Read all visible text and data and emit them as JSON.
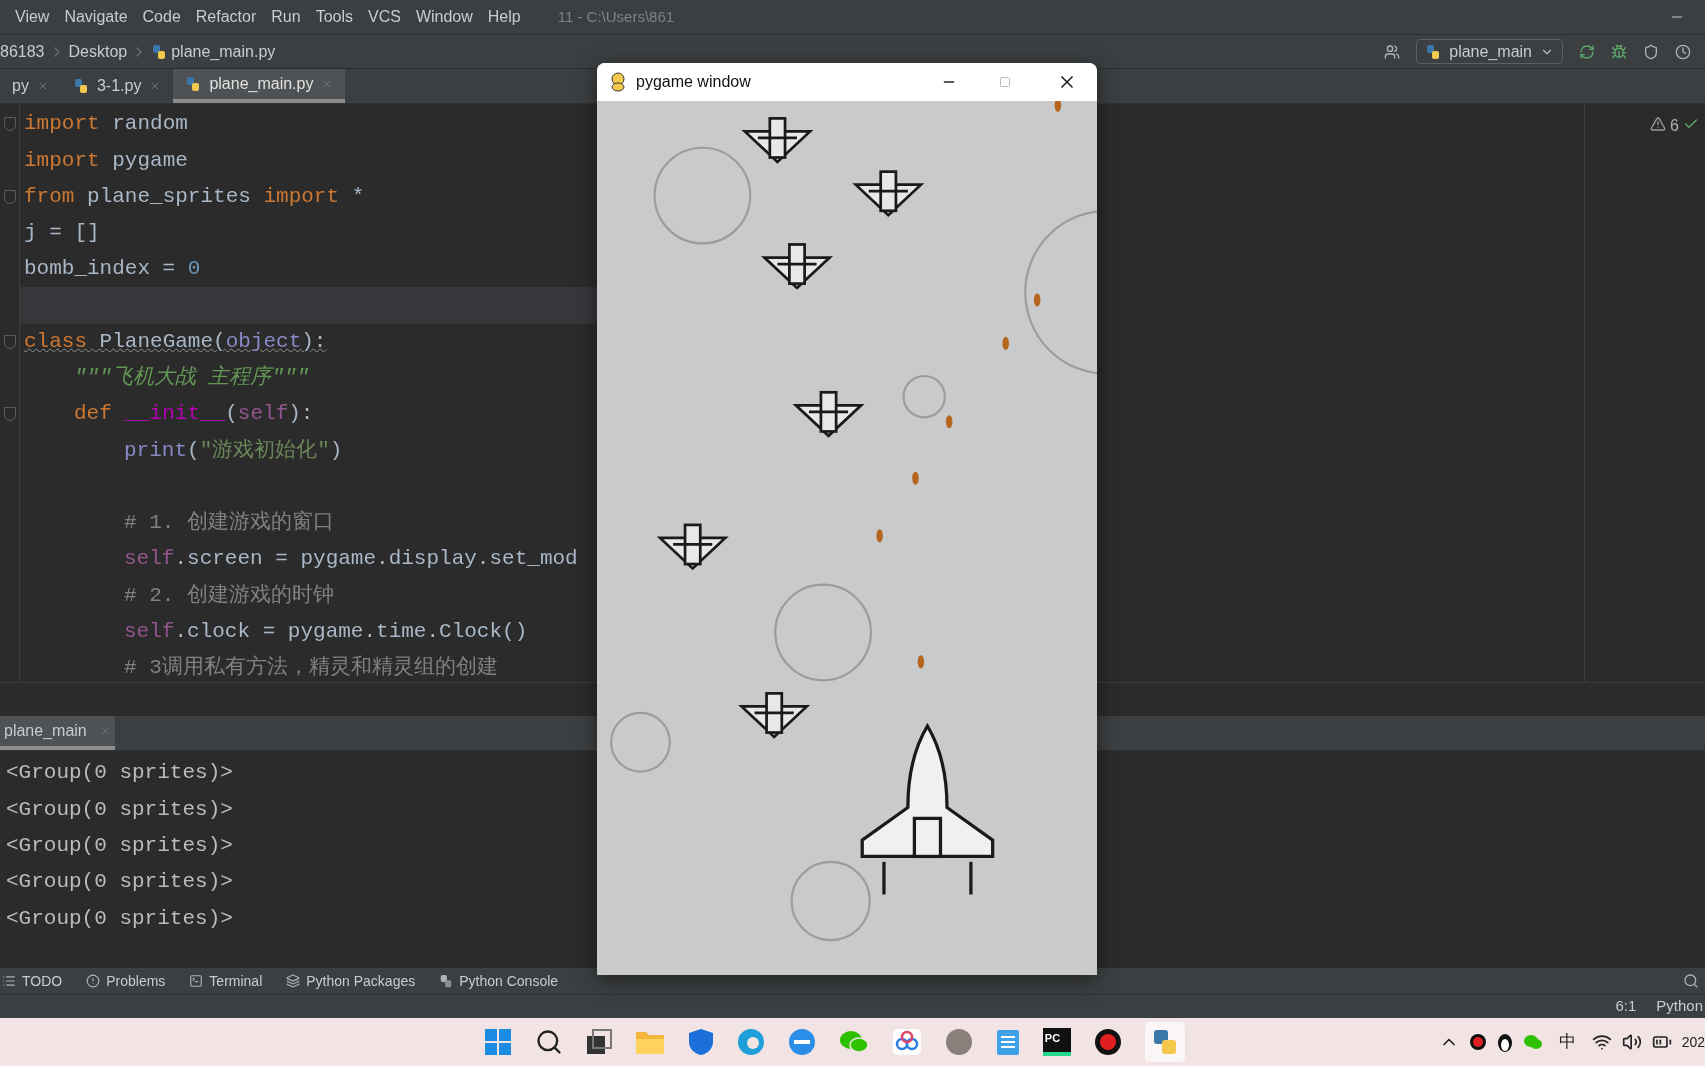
{
  "menu_bar": {
    "items": [
      "View",
      "Navigate",
      "Code",
      "Refactor",
      "Run",
      "Tools",
      "VCS",
      "Window",
      "Help"
    ],
    "title": "11 - C:\\Users\\861"
  },
  "breadcrumbs": [
    "86183",
    "Desktop",
    "plane_main.py"
  ],
  "toolbar": {
    "run_config": "plane_main"
  },
  "editor_tabs": [
    {
      "label": "py",
      "selected": false
    },
    {
      "label": "3-1.py",
      "selected": false
    },
    {
      "label": "plane_main.py",
      "selected": true
    }
  ],
  "editor": {
    "warning_count": "6",
    "lines": [
      {
        "kind": "code",
        "fold": true,
        "underlined": false,
        "tokens": [
          {
            "text": "import",
            "kind": "keyword"
          },
          {
            "text": " random",
            "kind": "plain"
          }
        ]
      },
      {
        "kind": "code",
        "fold": false,
        "underlined": false,
        "tokens": [
          {
            "text": "import",
            "kind": "keyword"
          },
          {
            "text": " pygame",
            "kind": "plain"
          }
        ]
      },
      {
        "kind": "code",
        "fold": true,
        "underlined": false,
        "tokens": [
          {
            "text": "from",
            "kind": "keyword"
          },
          {
            "text": " plane_sprites ",
            "kind": "plain"
          },
          {
            "text": "import",
            "kind": "keyword"
          },
          {
            "text": " *",
            "kind": "plain"
          }
        ]
      },
      {
        "kind": "code",
        "fold": false,
        "underlined": false,
        "tokens": [
          {
            "text": "j = []",
            "kind": "plain"
          }
        ]
      },
      {
        "kind": "code",
        "fold": false,
        "underlined": false,
        "tokens": [
          {
            "text": "bomb_index = ",
            "kind": "plain"
          },
          {
            "text": "0",
            "kind": "number"
          }
        ]
      },
      {
        "kind": "caret_line"
      },
      {
        "kind": "code",
        "fold": true,
        "underlined": true,
        "tokens": [
          {
            "text": "class",
            "kind": "keyword"
          },
          {
            "text": " PlaneGame(",
            "kind": "plain"
          },
          {
            "text": "object",
            "kind": "builtin"
          },
          {
            "text": "):",
            "kind": "plain"
          }
        ],
        "children": [
          {
            "kind": "code",
            "fold": false,
            "underlined": false,
            "tokens": [
              {
                "text": "\"\"\"飞机大战 主程序\"\"\"",
                "kind": "docstring"
              }
            ]
          },
          {
            "kind": "code",
            "fold": true,
            "underlined": false,
            "tokens": [
              {
                "text": "def",
                "kind": "keyword"
              },
              {
                "text": " __init__",
                "kind": "magic"
              },
              {
                "text": "(",
                "kind": "plain"
              },
              {
                "text": "self",
                "kind": "self"
              },
              {
                "text": "):",
                "kind": "plain"
              }
            ],
            "children": [
              {
                "kind": "code",
                "fold": false,
                "underlined": false,
                "tokens": [
                  {
                    "text": "print",
                    "kind": "builtin"
                  },
                  {
                    "text": "(",
                    "kind": "plain"
                  },
                  {
                    "text": "\"游戏初始化\"",
                    "kind": "string"
                  },
                  {
                    "text": ")",
                    "kind": "plain"
                  }
                ]
              },
              {
                "kind": "blank"
              },
              {
                "kind": "code",
                "fold": false,
                "underlined": false,
                "tokens": [
                  {
                    "text": "# 1. 创建游戏的窗口",
                    "kind": "comment"
                  }
                ]
              },
              {
                "kind": "code",
                "fold": false,
                "underlined": false,
                "tokens": [
                  {
                    "text": "self",
                    "kind": "self"
                  },
                  {
                    "text": ".screen = pygame.display.set_mod",
                    "kind": "plain"
                  }
                ]
              },
              {
                "kind": "code",
                "fold": false,
                "underlined": false,
                "tokens": [
                  {
                    "text": "# 2. 创建游戏的时钟",
                    "kind": "comment"
                  }
                ]
              },
              {
                "kind": "code",
                "fold": false,
                "underlined": false,
                "tokens": [
                  {
                    "text": "self",
                    "kind": "self"
                  },
                  {
                    "text": ".clock = pygame.time.Clock()",
                    "kind": "plain"
                  }
                ]
              },
              {
                "kind": "code",
                "fold": false,
                "underlined": false,
                "tokens": [
                  {
                    "text": "# 3调用私有方法，精灵和精灵组的创建",
                    "kind": "comment"
                  }
                ]
              }
            ]
          }
        ]
      }
    ]
  },
  "pygame_window": {
    "title": "pygame window"
  },
  "run_panel": {
    "tab": "plane_main",
    "output": [
      "<Group(0 sprites)>",
      "<Group(0 sprites)>",
      "<Group(0 sprites)>",
      "<Group(0 sprites)>",
      "<Group(0 sprites)>"
    ]
  },
  "tool_tabs": [
    {
      "label": "TODO",
      "kind": "list"
    },
    {
      "label": "Problems",
      "kind": "problems"
    },
    {
      "label": "Terminal",
      "kind": "terminal"
    },
    {
      "label": "Python Packages",
      "kind": "packages"
    },
    {
      "label": "Python Console",
      "kind": "console"
    }
  ],
  "status_bar": {
    "position": "6:1",
    "interpreter": "Python"
  },
  "taskbar": {
    "app_label": "PC",
    "input_method": "中",
    "clock": "202"
  }
}
